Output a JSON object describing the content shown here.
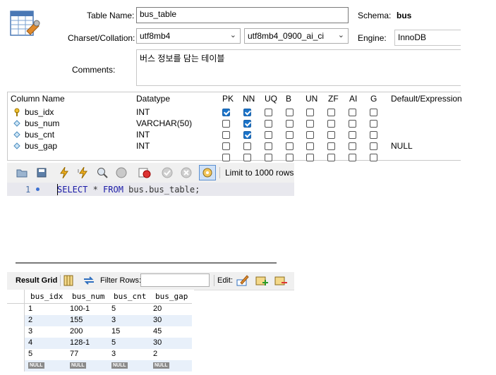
{
  "table": {
    "name_label": "Table Name:",
    "name_value": "bus_table",
    "schema_label": "Schema:",
    "schema_value": "bus",
    "charset_label": "Charset/Collation:",
    "charset_value": "utf8mb4",
    "collation_value": "utf8mb4_0900_ai_ci",
    "engine_label": "Engine:",
    "engine_value": "InnoDB",
    "comments_label": "Comments:",
    "comments_value": "버스 정보를 담는 테이블"
  },
  "columns": {
    "headers": [
      "Column Name",
      "Datatype",
      "PK",
      "NN",
      "UQ",
      "B",
      "UN",
      "ZF",
      "AI",
      "G",
      "Default/Expression"
    ],
    "rows": [
      {
        "name": "bus_idx",
        "type": "INT",
        "icon": "key-icon",
        "flags": [
          true,
          true,
          false,
          false,
          false,
          false,
          false,
          false
        ],
        "default": ""
      },
      {
        "name": "bus_num",
        "type": "VARCHAR(50)",
        "icon": "column-diamond-icon",
        "flags": [
          false,
          true,
          false,
          false,
          false,
          false,
          false,
          false
        ],
        "default": ""
      },
      {
        "name": "bus_cnt",
        "type": "INT",
        "icon": "column-diamond-icon",
        "flags": [
          false,
          true,
          false,
          false,
          false,
          false,
          false,
          false
        ],
        "default": ""
      },
      {
        "name": "bus_gap",
        "type": "INT",
        "icon": "column-diamond-icon",
        "flags": [
          false,
          false,
          false,
          false,
          false,
          false,
          false,
          false
        ],
        "default": "NULL"
      },
      {
        "name": "",
        "type": "",
        "icon": "",
        "flags": [
          false,
          false,
          false,
          false,
          false,
          false,
          false,
          false
        ],
        "default": ""
      }
    ]
  },
  "query": {
    "limit_label": "Limit to 1000 rows",
    "line_number": "1",
    "sql": {
      "kw1": "SELECT",
      "star": " * ",
      "kw2": "FROM",
      "rest": " bus.bus_table;"
    }
  },
  "result": {
    "tab_label": "Result Grid",
    "filter_label": "Filter Rows:",
    "filter_value": "",
    "edit_label": "Edit:",
    "headers": [
      "bus_idx",
      "bus_num",
      "bus_cnt",
      "bus_gap"
    ],
    "rows": [
      [
        "1",
        "100-1",
        "5",
        "20"
      ],
      [
        "2",
        "155",
        "3",
        "30"
      ],
      [
        "3",
        "200",
        "15",
        "45"
      ],
      [
        "4",
        "128-1",
        "5",
        "30"
      ],
      [
        "5",
        "77",
        "3",
        "2"
      ]
    ],
    "null_label": "NULL"
  },
  "colors": {
    "checkbox_on": "#1a73c9",
    "keyword": "#1a1aa6",
    "row_alt": "#e8f0fa"
  }
}
